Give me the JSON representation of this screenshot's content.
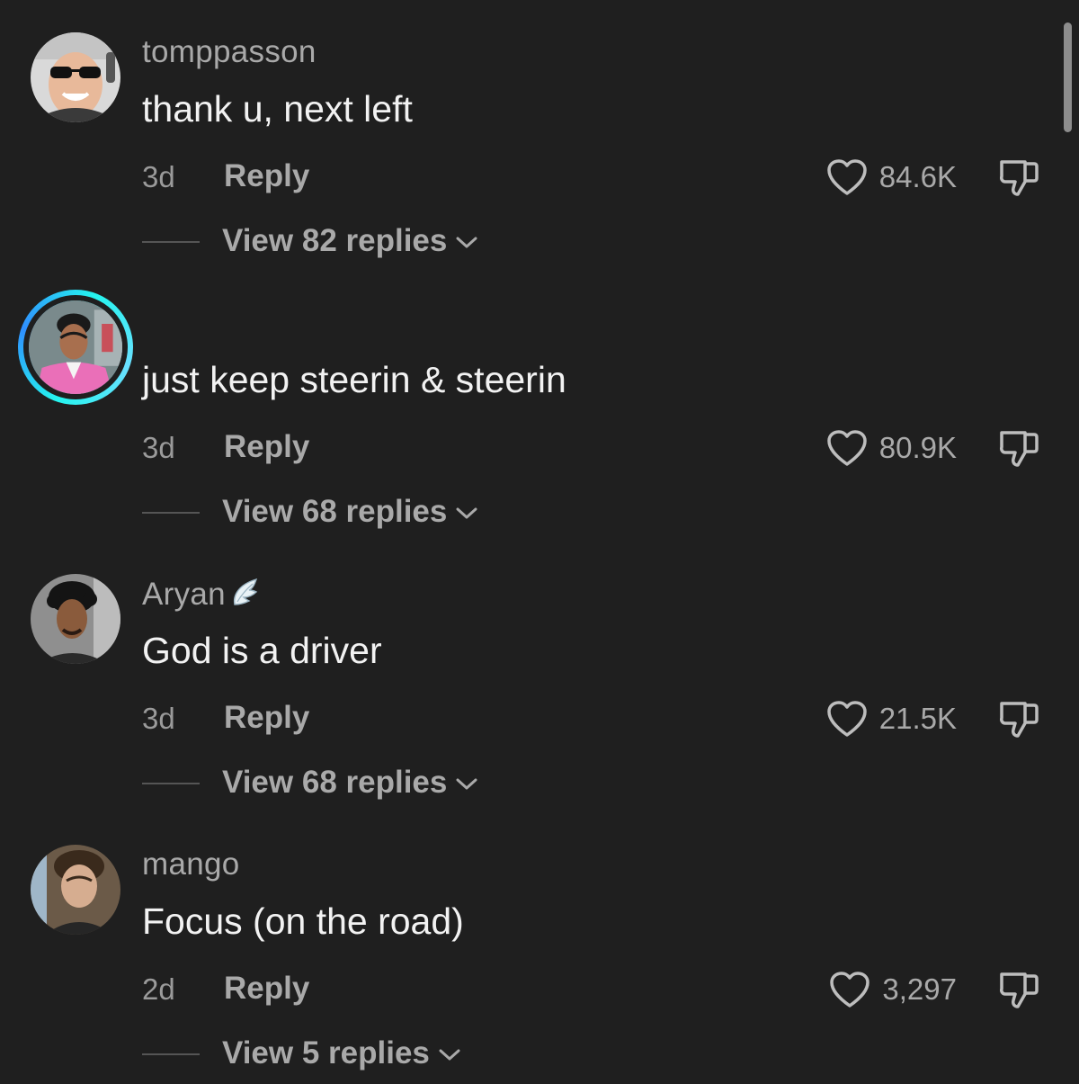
{
  "comments": [
    {
      "username": "tomppasson",
      "text": "thank u, next left",
      "time": "3d",
      "reply_label": "Reply",
      "likes": "84.6K",
      "view_replies": "View 82 replies",
      "avatar": "avatar-sunglasses-man",
      "has_story_ring": false
    },
    {
      "username": "",
      "text": "just keep steerin & steerin",
      "time": "3d",
      "reply_label": "Reply",
      "likes": "80.9K",
      "view_replies": "View 68 replies",
      "avatar": "avatar-woman-pink-jacket",
      "has_story_ring": true
    },
    {
      "username": "Aryan",
      "username_badge": "wing-emoji",
      "text": "God is a driver",
      "time": "3d",
      "reply_label": "Reply",
      "likes": "21.5K",
      "view_replies": "View 68 replies",
      "avatar": "avatar-curly-hair-man",
      "has_story_ring": false
    },
    {
      "username": "mango",
      "text": "Focus (on the road)",
      "time": "2d",
      "reply_label": "Reply",
      "likes": "3,297",
      "view_replies": "View 5 replies",
      "avatar": "avatar-young-man",
      "has_story_ring": false
    }
  ],
  "icons": {
    "like": "heart-outline-icon",
    "dislike": "thumbs-down-icon",
    "expand": "chevron-down-icon"
  },
  "colors": {
    "background": "#1f1f1f",
    "primary_text": "#f2f2f2",
    "secondary_text": "#a9a9a9",
    "story_ring": "#25f4ee"
  }
}
